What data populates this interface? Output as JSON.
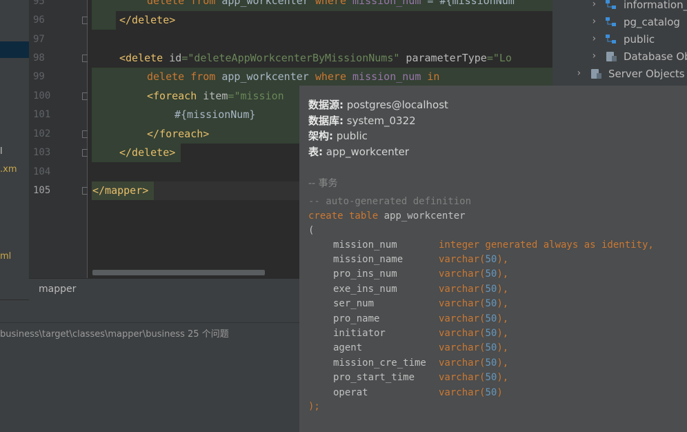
{
  "editor": {
    "lines": [
      {
        "num": "95"
      },
      {
        "num": "96"
      },
      {
        "num": "97"
      },
      {
        "num": "98"
      },
      {
        "num": "99"
      },
      {
        "num": "100"
      },
      {
        "num": "101"
      },
      {
        "num": "102"
      },
      {
        "num": "103"
      },
      {
        "num": "104"
      },
      {
        "num": "105"
      }
    ],
    "code": {
      "l95_kw1": "delete",
      "l95_kw2": "from",
      "l95_tbl": "app_workcenter",
      "l95_kw3": "where",
      "l95_col": "mission_num",
      "l95_eq": " = #{missionNum",
      "l96": "</delete>",
      "l98_open": "<delete ",
      "l98_attr": "id",
      "l98_eq": "=",
      "l98_val": "\"deleteAppWorkcenterByMissionNums\"",
      "l98_attr2": " parameterType",
      "l98_eq2": "=",
      "l98_val2": "\"Lo",
      "l99_kw1": "delete",
      "l99_kw2": "from",
      "l99_tbl": "app_workcenter",
      "l99_kw3": "where",
      "l99_col": "mission_num",
      "l99_kw4": "in",
      "l100_open": "<foreach ",
      "l100_attr": "item",
      "l100_eq": "=",
      "l100_val": "\"mission",
      "l101": "#{missionNum}",
      "l102": "</foreach>",
      "l103": "</delete>",
      "l105": "</mapper>"
    }
  },
  "left_fragments": [
    "l",
    ".xm",
    "ml"
  ],
  "breadcrumb": {
    "label": "mapper"
  },
  "bottom_panel": {
    "path": "business\\target\\classes\\mapper\\business",
    "problems": "25 个问题"
  },
  "db_tree": {
    "items": [
      {
        "label": "information_"
      },
      {
        "label": "pg_catalog"
      },
      {
        "label": "public"
      },
      {
        "label": "Database Ob"
      },
      {
        "label": "Server Objects"
      }
    ]
  },
  "popup": {
    "datasource_label": "数据源:",
    "datasource_value": "postgres@localhost",
    "database_label": "数据库:",
    "database_value": "system_0322",
    "schema_label": "架构:",
    "schema_value": "public",
    "table_label": "表:",
    "table_value": "app_workcenter",
    "transaction_comment": "-- 事务",
    "autogen_comment": "-- auto-generated definition",
    "create_kw": "create table",
    "table_name": "app_workcenter",
    "open_paren": "(",
    "close_paren": ");",
    "first_col_type": "integer generated always as identity,",
    "columns": [
      {
        "name": "mission_name",
        "type": "varchar",
        "len": "50",
        "end": "),"
      },
      {
        "name": "pro_ins_num",
        "type": "varchar",
        "len": "50",
        "end": "),"
      },
      {
        "name": "exe_ins_num",
        "type": "varchar",
        "len": "50",
        "end": "),"
      },
      {
        "name": "ser_num",
        "type": "varchar",
        "len": "50",
        "end": "),"
      },
      {
        "name": "pro_name",
        "type": "varchar",
        "len": "50",
        "end": "),"
      },
      {
        "name": "initiator",
        "type": "varchar",
        "len": "50",
        "end": "),"
      },
      {
        "name": "agent",
        "type": "varchar",
        "len": "50",
        "end": "),"
      },
      {
        "name": "mission_cre_time",
        "type": "varchar",
        "len": "50",
        "end": "),"
      },
      {
        "name": "pro_start_time",
        "type": "varchar",
        "len": "50",
        "end": "),"
      },
      {
        "name": "operat",
        "type": "varchar",
        "len": "50",
        "end": ")"
      }
    ],
    "first_col_name": "mission_num"
  },
  "colors": {
    "keyword": "#cc7832",
    "tag": "#e8bf6a",
    "string": "#6a8759",
    "number": "#6897bb",
    "popup_bg": "#4b4d4e"
  }
}
